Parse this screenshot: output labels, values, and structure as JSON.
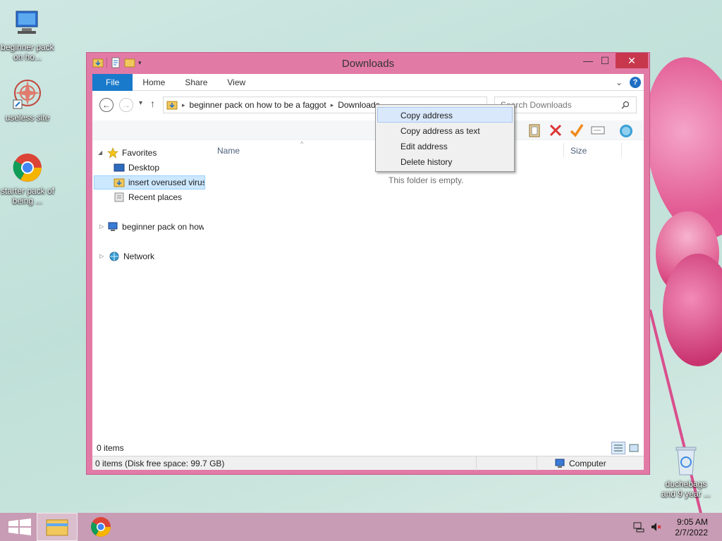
{
  "desktop": {
    "icons": [
      {
        "label": "beginner pack on ho..."
      },
      {
        "label": "useless site"
      },
      {
        "label": "starter pack of being ..."
      },
      {
        "label": "duchebags and 9 year ..."
      }
    ]
  },
  "window": {
    "title": "Downloads",
    "controls": {
      "minimize": "—",
      "maximize": "☐",
      "close": "✕"
    },
    "ribbon_tabs": [
      "File",
      "Home",
      "Share",
      "View"
    ],
    "help": "?",
    "nav": {
      "back": "←",
      "forward": "→",
      "recent": "▾",
      "up": "↑"
    },
    "address": {
      "segments": [
        "beginner pack on how to be a faggot",
        "Downloads"
      ],
      "separator": "▸"
    },
    "search": {
      "placeholder": "Search Downloads"
    },
    "nav_pane": {
      "favorites": "Favorites",
      "desktop": "Desktop",
      "downloads_item": "insert overused virus",
      "recent": "Recent places",
      "computer": "beginner pack on how",
      "network": "Network"
    },
    "columns": {
      "name": "Name",
      "size": "Size"
    },
    "empty_message": "This folder is empty.",
    "status": {
      "item_count": "0 items",
      "disk": "0 items (Disk free space: 99.7 GB)",
      "location": "Computer"
    }
  },
  "context_menu": {
    "items": [
      "Copy address",
      "Copy address as text",
      "Edit address",
      "Delete history"
    ],
    "highlighted_index": 0
  },
  "taskbar": {
    "time": "9:05 AM",
    "date": "2/7/2022"
  },
  "colors": {
    "window_frame": "#e27aa6",
    "close_button": "#c7384d",
    "file_tab": "#1979ca",
    "taskbar": "#c89cb4"
  }
}
